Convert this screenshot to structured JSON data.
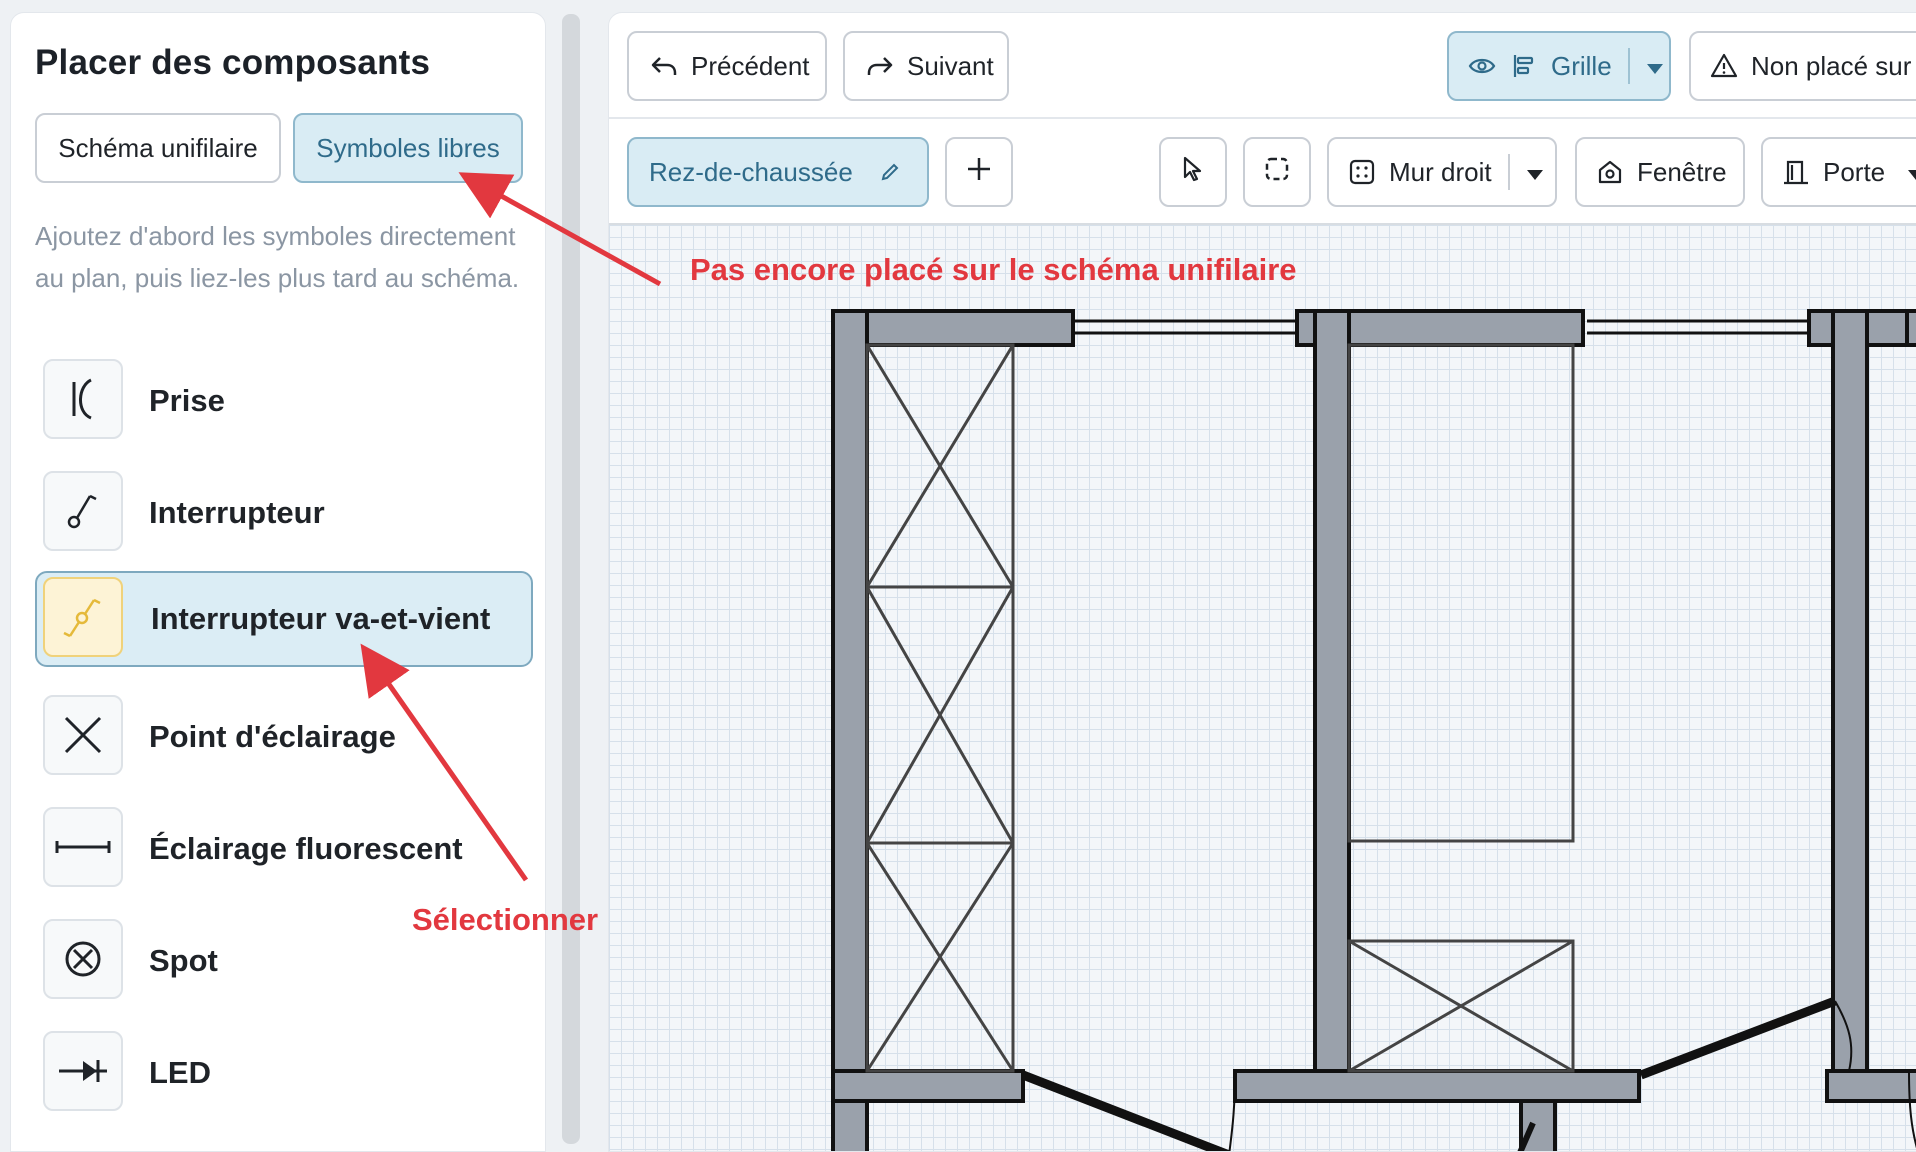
{
  "left_panel": {
    "title": "Placer des composants",
    "modes": [
      "Schéma unifilaire",
      "Symboles libres"
    ],
    "hint": "Ajoutez d'abord les symboles directement au plan, puis liez-les plus tard au schéma.",
    "components": [
      {
        "label": "Prise",
        "icon": "socket-icon"
      },
      {
        "label": "Interrupteur",
        "icon": "switch-icon"
      },
      {
        "label": "Interrupteur va-et-vient",
        "icon": "two-way-switch-icon",
        "selected": true
      },
      {
        "label": "Point d'éclairage",
        "icon": "light-point-icon"
      },
      {
        "label": "Éclairage fluorescent",
        "icon": "fluorescent-icon"
      },
      {
        "label": "Spot",
        "icon": "spot-icon"
      },
      {
        "label": "LED",
        "icon": "led-icon"
      }
    ]
  },
  "toolbar": {
    "undo": "Précédent",
    "redo": "Suivant",
    "grid": "Grille",
    "unplaced": "Non placé sur l"
  },
  "floor_toolbar": {
    "floor": "Rez-de-chaussée",
    "wall": "Mur droit",
    "window": "Fenêtre",
    "door": "Porte"
  },
  "annotations": {
    "not_placed": "Pas encore placé sur le schéma unifilaire",
    "select": "Sélectionner"
  },
  "colors": {
    "accent_bg": "#d9ecf4",
    "accent_text": "#2f6b8a",
    "annotation": "#e2383f",
    "selected_icon_bg": "#fdf3d6",
    "wall_fill": "#9aa1ab"
  }
}
